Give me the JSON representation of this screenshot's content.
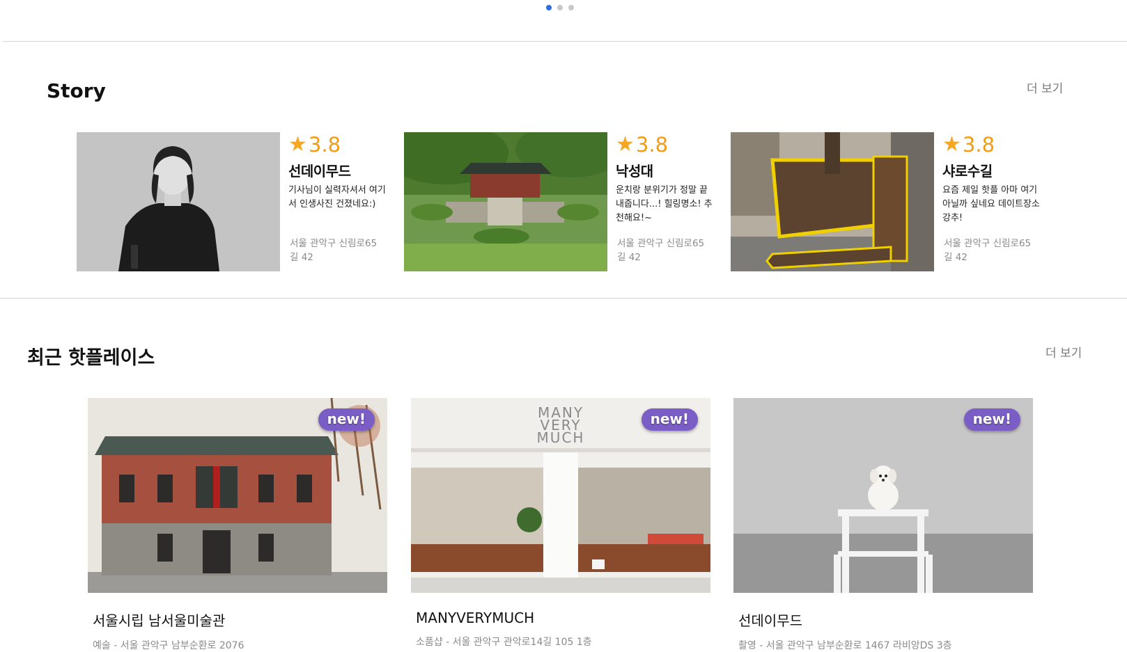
{
  "carousel": {
    "count": 3,
    "active": 0
  },
  "story": {
    "title": "Story",
    "more_label": "더 보기",
    "items": [
      {
        "rating": "3.8",
        "name": "선데이무드",
        "desc": "기사님이 실력자셔서 여기서 인생사진 건졌네요:)",
        "address": "서울 관악구 신림로65길 42",
        "image": "portrait"
      },
      {
        "rating": "3.8",
        "name": "낙성대",
        "desc": "운치랑 분위기가 정말 끝내줍니다...! 힐링명소! 추천해요!~",
        "address": "서울 관악구 신림로65길 42",
        "image": "shrine-garden"
      },
      {
        "rating": "3.8",
        "name": "샤로수길",
        "desc": "요즘 제일 핫플 아마 여기아닐까 싶네요 데이트장소 강추!",
        "address": "서울 관악구 신림로65길 42",
        "image": "street-sign"
      }
    ]
  },
  "hot": {
    "title": "최근 핫플레이스",
    "more_label": "더 보기",
    "items": [
      {
        "badge": "new!",
        "name": "서울시립 남서울미술관",
        "meta": "예술 - 서울 관악구 남부순환로 2076",
        "image": "brick-building"
      },
      {
        "badge": "new!",
        "name": "MANYVERYMUCH",
        "meta": "소품샵 - 서울 관악구 관악로14길 105 1층",
        "image": "shop-front",
        "sign_lines": [
          "MANY",
          "VERY",
          "MUCH"
        ]
      },
      {
        "badge": "new!",
        "name": "선데이무드",
        "meta": "촬영 - 서울 관악구 남부순환로 1467 라비앙DS 3층",
        "image": "dog-on-stool"
      }
    ]
  },
  "colors": {
    "accent": "#2a6fdb",
    "star": "#f5a623",
    "badge": "#7b5dc6",
    "muted": "#8a8a8a"
  }
}
